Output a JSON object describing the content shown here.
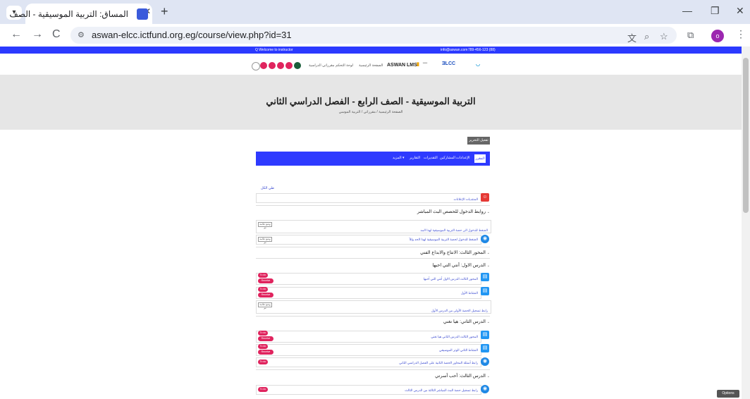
{
  "browser": {
    "tab_title": "المساق: التربية الموسيقية - الصف",
    "url": "aswan-elcc.ictfund.org.eg/course/view.php?id=31",
    "tab_search_icon": "chevron-down-icon",
    "new_tab": "+",
    "minimize": "—",
    "restore": "❐",
    "close": "✕",
    "back": "←",
    "forward": "→",
    "reload": "C",
    "profile_initial": "o"
  },
  "site": {
    "topbar_left": "Q    Welcome to instructor",
    "topbar_email": "info@aswan.com",
    "topbar_phone": "789-456-123 (88)",
    "lms_name": "ASWAN LMS",
    "menu": [
      "الصفحة الرئيسية",
      "لوحة التحكم",
      "مقرراتي الدراسية"
    ],
    "accent": "#2e3aff"
  },
  "hero": {
    "title": "التربية الموسيقية - الصف الرابع - الفصل الدراسي الثاني",
    "breadcrumb": "الصفحة الرئيسية / مقرراتي / التربية الموسي"
  },
  "course": {
    "edit_button": "تفعيل التحرير",
    "nav": [
      "المقرر",
      "الإعدادات",
      "المشاركين",
      "التقديرات",
      "التقارير",
      "المزيد ▾"
    ],
    "collapse_all": "طي الكل",
    "announcements": "المنتديات الإعلانات",
    "sections": [
      {
        "title": "روابط الدخول للحصص البث المباشر"
      },
      {
        "title": "المحور الثالث: الانتاج والابداع الفني"
      },
      {
        "title": "الدرس الاول: أنتي التي احبها"
      },
      {
        "title": "الدرس الثاني: هيا نغني"
      },
      {
        "title": "الدرس الثالث: أحب أسرتي"
      }
    ],
    "activities": {
      "live1": "الضغط للدخول الى حصة التربية الموسيقية لهذا المد",
      "live2": "الضغط للدخول لحصة التربية الموسيقية لهذا الحد وللأ",
      "l1a": "المحور الثالث الدرس الاول أنتي التي أحبها",
      "l1b": "النشاط الأول",
      "l1c": "رابط تسجيل الحصة الأولى من الدرس الأول",
      "l2a": "المحور الثالث الدرس الثاني هيا نغني",
      "l2b": "النشاط الثاني الوتر الموسيقي",
      "l2c": "رابط أسئلة المحاور الحصة الثانية على الفصل الدراسي الثاني",
      "l3a": "رابط تسجيل حصة البث المباشر الثالثة من الدرس الثالث"
    },
    "mark_done": "وضع علامة تم",
    "pill_to_do": "To do",
    "pill_receive": "Receive grade",
    "options_button": "Options"
  }
}
